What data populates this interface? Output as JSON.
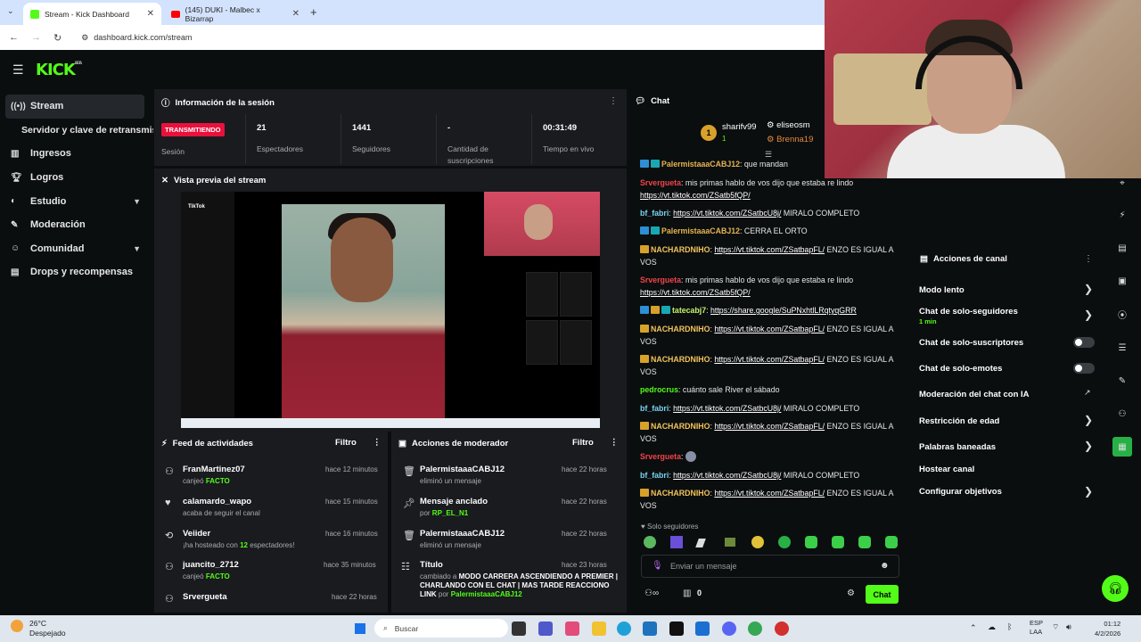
{
  "browser": {
    "tabs": [
      {
        "label": "Stream - Kick Dashboard"
      },
      {
        "label": "(145) DUKI - Malbec x Bizarrap"
      }
    ],
    "url": "dashboard.kick.com/stream"
  },
  "app": {
    "logo": "KICK",
    "beta": "BETA"
  },
  "sidebar": {
    "items": [
      {
        "label": "Stream"
      },
      {
        "label": "Servidor y clave de retransmisión"
      },
      {
        "label": "Ingresos"
      },
      {
        "label": "Logros"
      },
      {
        "label": "Estudio"
      },
      {
        "label": "Moderación"
      },
      {
        "label": "Comunidad"
      },
      {
        "label": "Drops y recompensas"
      }
    ]
  },
  "session": {
    "title": "Información de la sesión",
    "status": "TRANSMITIENDO",
    "status_label": "Sesión",
    "stats": [
      {
        "value": "21",
        "label": "Espectadores"
      },
      {
        "value": "1441",
        "label": "Seguidores"
      },
      {
        "value": "-",
        "label": "Cantidad de suscripciones"
      },
      {
        "value": "00:31:49",
        "label": "Tiempo en vivo"
      }
    ]
  },
  "preview": {
    "title": "Vista previa del stream",
    "tiktok": "TikTok"
  },
  "feed": {
    "title": "Feed de actividades",
    "filter": "Filtro",
    "items": [
      {
        "name": "FranMartinez07",
        "pre": "canjeó",
        "hl": "FACTO",
        "post": "",
        "time": "hace 12 minutos"
      },
      {
        "name": "calamardo_wapo",
        "pre": "acaba de seguir el canal",
        "hl": "",
        "post": "",
        "time": "hace 15 minutos"
      },
      {
        "name": "Veiider",
        "pre": "¡ha hosteado con",
        "hl": "12",
        "post": "espectadores!",
        "time": "hace 16 minutos"
      },
      {
        "name": "juancito_2712",
        "pre": "canjeó",
        "hl": "FACTO",
        "post": "",
        "time": "hace 35 minutos"
      },
      {
        "name": "Srvergueta",
        "pre": "",
        "hl": "",
        "post": "",
        "time": "hace 22 horas"
      }
    ]
  },
  "modactions": {
    "title": "Acciones de moderador",
    "filter": "Filtro",
    "items": [
      {
        "name": "PalermistaaaCABJ12",
        "sub": "eliminó un mensaje",
        "time": "hace 22 horas"
      },
      {
        "name": "Mensaje anclado",
        "sub": "por",
        "hl": "RP_EL_N1",
        "time": "hace 22 horas"
      },
      {
        "name": "PalermistaaaCABJ12",
        "sub": "eliminó un mensaje",
        "time": "hace 22 horas"
      },
      {
        "name": "Título",
        "sub": "cambiado a",
        "hl": "MODO CARRERA ASCENDIENDO A PREMIER | CHARLANDO CON EL CHAT | MAS TARDE REACCIONO LINK",
        "by": "por",
        "byname": "PalermistaaaCABJ12",
        "time": "hace 23 horas"
      }
    ]
  },
  "chat": {
    "title": "Chat",
    "top": [
      {
        "rank": "1",
        "name": "sharifv99",
        "count": "1"
      },
      {
        "name": "eliseosm"
      },
      {
        "name": "Brenna19"
      }
    ],
    "messages": [
      {
        "user": "PalermistaaaCABJ12",
        "text": ": que mandan",
        "link": ""
      },
      {
        "user": "Srvergueta",
        "text": ": mis primas hablo de vos dijo que estaba re lindo",
        "link": "https://vt.tiktok.com/ZSatb5fQP/"
      },
      {
        "user": "bf_fabri",
        "text": "MIRALO COMPLETO",
        "link": "https://vt.tiktok.com/ZSatbcU8j/"
      },
      {
        "user": "PalermistaaaCABJ12",
        "text": ": CERRA EL ORTO",
        "link": ""
      },
      {
        "user": "NACHARDNIHO",
        "text": "ENZO ES IGUAL A VOS",
        "link": "https://vt.tiktok.com/ZSatbapFL/"
      },
      {
        "user": "Srvergueta",
        "text": ": mis primas hablo de vos dijo que estaba re lindo",
        "link": "https://vt.tiktok.com/ZSatb5fQP/"
      },
      {
        "user": "tatecabj7",
        "text": "",
        "link": "https://share.google/SuPNxhtlLRqtyqGRR"
      },
      {
        "user": "NACHARDNIHO",
        "text": "ENZO ES IGUAL A VOS",
        "link": "https://vt.tiktok.com/ZSatbapFL/"
      },
      {
        "user": "NACHARDNIHO",
        "text": "ENZO ES IGUAL A VOS",
        "link": "https://vt.tiktok.com/ZSatbapFL/"
      },
      {
        "user": "pedrocrus",
        "text": ": cuánto sale River el sábado",
        "link": ""
      },
      {
        "user": "bf_fabri",
        "text": "MIRALO COMPLETO",
        "link": "https://vt.tiktok.com/ZSatbcU8j/"
      },
      {
        "user": "NACHARDNIHO",
        "text": "ENZO ES IGUAL A VOS",
        "link": "https://vt.tiktok.com/ZSatbapFL/"
      },
      {
        "user": "Srvergueta",
        "text": ":",
        "link": ""
      },
      {
        "user": "bf_fabri",
        "text": "MIRALO COMPLETO",
        "link": "https://vt.tiktok.com/ZSatbcU8j/"
      },
      {
        "user": "NACHARDNIHO",
        "text": "ENZO ES IGUAL A VOS",
        "link": "https://vt.tiktok.com/ZSatbapFL/"
      }
    ],
    "followers_only": "Solo seguidores",
    "placeholder": "Enviar un mensaje",
    "send": "Chat",
    "points": "0"
  },
  "channel_actions": {
    "title": "Acciones de canal",
    "items": [
      {
        "label": "Modo lento"
      },
      {
        "label": "Chat de solo-seguidores",
        "sub": "1 min"
      },
      {
        "label": "Chat de solo-suscriptores"
      },
      {
        "label": "Chat de solo-emotes"
      },
      {
        "label": "Moderación del chat con IA"
      },
      {
        "label": "Restricción de edad"
      },
      {
        "label": "Palabras baneadas"
      },
      {
        "label": "Hostear canal"
      },
      {
        "label": "Configurar objetivos"
      }
    ]
  },
  "taskbar": {
    "temp": "26°C",
    "weather": "Despejado",
    "search": "Buscar",
    "lang1": "ESP",
    "lang2": "LAA",
    "time": "01:12",
    "date": "4/2/2026"
  },
  "colors": {
    "accent": "#53fc18",
    "live": "#e9113c",
    "panel": "#191b1f"
  }
}
